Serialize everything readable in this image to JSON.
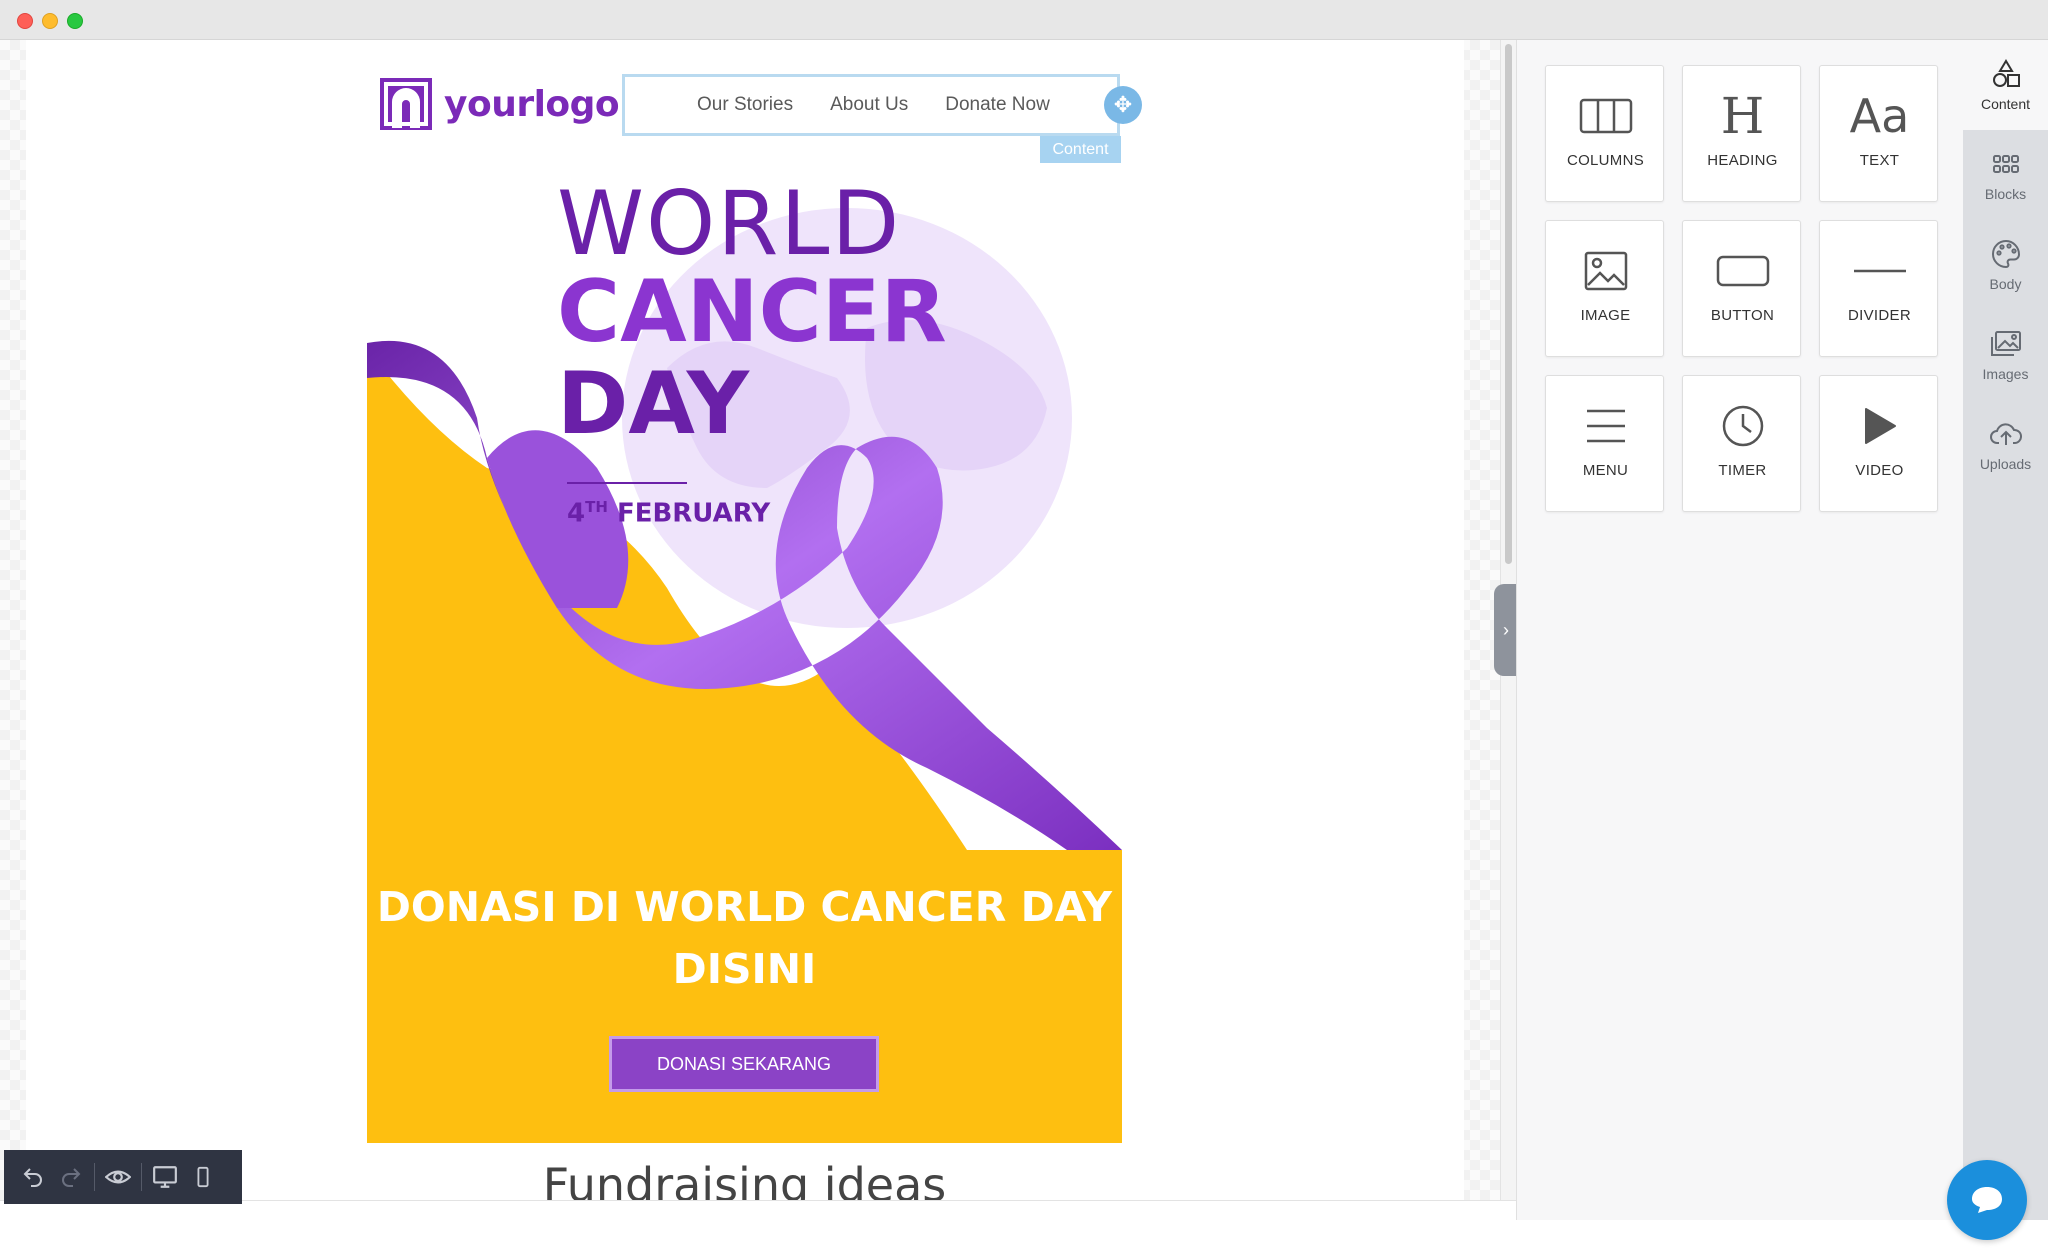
{
  "email": {
    "logo_text": "yourlogo",
    "menu": [
      "Our Stories",
      "About Us",
      "Donate Now"
    ],
    "selected_tag": "Content",
    "hero": {
      "line1": "WORLD",
      "line2": "CANCER",
      "line3": "DAY",
      "date_prefix": "4",
      "date_sup": "TH",
      "date_rest": " FEBRUARY",
      "headline_1": "DONASI DI WORLD CANCER DAY",
      "headline_2": "DISINI",
      "cta_label": "DONASI SEKARANG",
      "accent": "#febf10",
      "ribbon": "#8b43c6"
    },
    "next_section_title": "Fundraising ideas"
  },
  "tools": [
    {
      "label": "COLUMNS",
      "icon": "columns-icon"
    },
    {
      "label": "HEADING",
      "icon": "heading-icon"
    },
    {
      "label": "TEXT",
      "icon": "text-icon"
    },
    {
      "label": "IMAGE",
      "icon": "image-icon"
    },
    {
      "label": "BUTTON",
      "icon": "button-icon"
    },
    {
      "label": "DIVIDER",
      "icon": "divider-icon"
    },
    {
      "label": "MENU",
      "icon": "menu-icon"
    },
    {
      "label": "TIMER",
      "icon": "timer-icon"
    },
    {
      "label": "VIDEO",
      "icon": "video-icon"
    }
  ],
  "side_tabs": [
    {
      "label": "Content",
      "icon": "shapes-icon",
      "active": true
    },
    {
      "label": "Blocks",
      "icon": "grid-icon"
    },
    {
      "label": "Body",
      "icon": "palette-icon"
    },
    {
      "label": "Images",
      "icon": "images-icon"
    },
    {
      "label": "Uploads",
      "icon": "cloud-upload-icon"
    }
  ],
  "colors": {
    "brand": "#7b2ab8",
    "selection": "#b9daf0",
    "chat": "#1b8fdc"
  }
}
